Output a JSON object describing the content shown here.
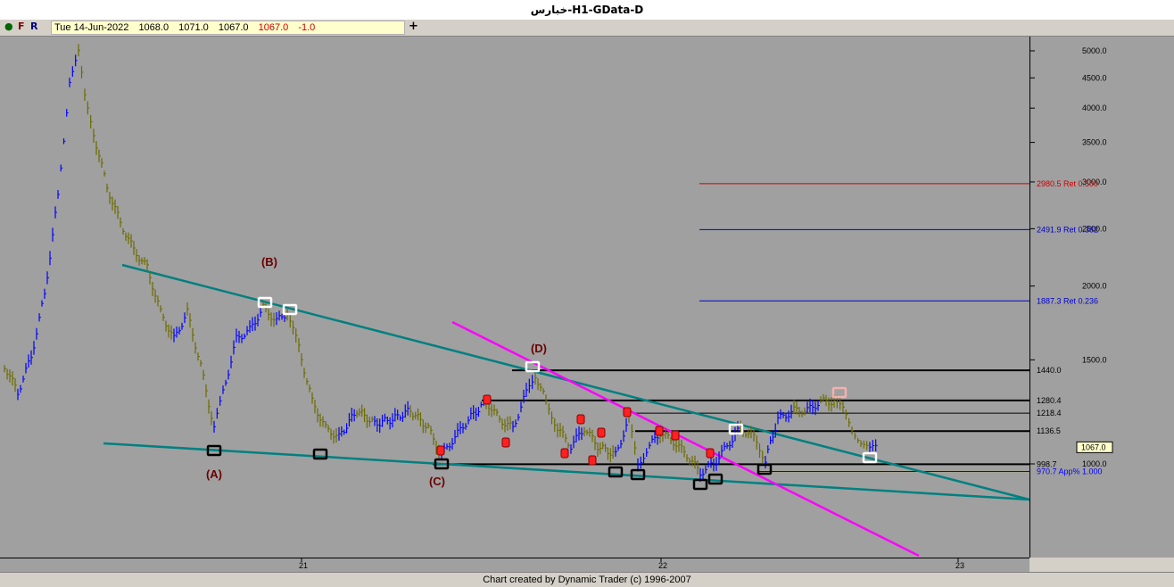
{
  "window": {
    "title": "خبارس-H1-GData-D"
  },
  "toolbar": {
    "icons": [
      "circle-icon",
      "F",
      "R"
    ],
    "quote": {
      "date": "Tue 14-Jun-2022",
      "open": "1068.0",
      "high": "1071.0",
      "low": "1067.0",
      "close": "1067.0",
      "change": "-1.0"
    },
    "plus": "+"
  },
  "footer": {
    "credit": "Chart created by Dynamic Trader  (c) 1996-2007"
  },
  "colors": {
    "background": "#a0a0a0",
    "up_bar": "#0000ff",
    "down_bar": "#6b6b00",
    "trendline": "#008080",
    "magenta_line": "#ff00ff",
    "wave_label": "#6b0000"
  },
  "chart_data": {
    "type": "ohlc",
    "y_scale": "log",
    "y_ticks": [
      "5000.0",
      "4500.0",
      "4000.0",
      "3500.0",
      "3000.0",
      "2500.0",
      "2000.0",
      "1500.0",
      "1000.0"
    ],
    "x_ticks": [
      "21",
      "22",
      "23"
    ],
    "current_price_label": "1067.0",
    "wave_labels": [
      "(A)",
      "(B)",
      "(C)",
      "(D)"
    ],
    "horizontal_levels": [
      {
        "value": 1440.0,
        "label": "1440.0",
        "color": "#000000"
      },
      {
        "value": 1280.4,
        "label": "1280.4",
        "color": "#000000"
      },
      {
        "value": 1218.4,
        "label": "1218.4",
        "color": "#000000"
      },
      {
        "value": 1136.5,
        "label": "1136.5",
        "color": "#000000"
      },
      {
        "value": 998.7,
        "label": "998.7",
        "color": "#000000"
      },
      {
        "value": 970.7,
        "label": "970.7 App% 1.000",
        "color": "#0000ff"
      }
    ],
    "retracements": [
      {
        "value": 2980.5,
        "label": "2980.5 Ret 0.500",
        "color": "#cc0000"
      },
      {
        "value": 2491.9,
        "label": "2491.9 Ret 0.382",
        "color": "#0000cc"
      },
      {
        "value": 1887.3,
        "label": "1887.3 Ret 0.236",
        "color": "#0000cc"
      }
    ]
  }
}
